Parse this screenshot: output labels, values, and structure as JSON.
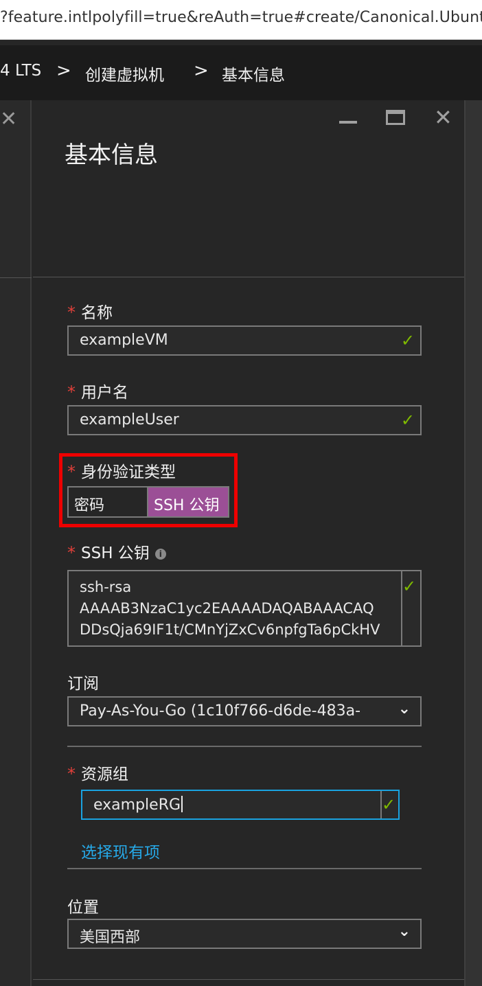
{
  "browser": {
    "url": "?feature.intlpolyfill=true&reAuth=true#create/Canonical.Ubunt"
  },
  "breadcrumb": {
    "items": [
      "4 LTS",
      "创建虚拟机",
      "基本信息"
    ],
    "separator": ">"
  },
  "blade": {
    "title": "基本信息",
    "icons": [
      "minimize-icon",
      "maximize-icon",
      "close-icon"
    ]
  },
  "form": {
    "required_mark": "*",
    "name": {
      "label": "名称",
      "value": "exampleVM",
      "valid": true
    },
    "username": {
      "label": "用户名",
      "value": "exampleUser",
      "valid": true
    },
    "auth_type": {
      "label": "身份验证类型",
      "options": [
        "密码",
        "SSH 公钥"
      ],
      "selected": "SSH 公钥"
    },
    "ssh_key": {
      "label": "SSH 公钥",
      "lines": [
        "ssh-rsa",
        "AAAAB3NzaC1yc2EAAAADAQABAAACAQ",
        "DDsQja69IF1t/CMnYjZxCv6npfgTa6pCkHV"
      ],
      "valid": true
    },
    "subscription": {
      "label": "订阅",
      "value": "Pay-As-You-Go (1c10f766-d6de-483a-"
    },
    "resource_group": {
      "label": "资源组",
      "value": "exampleRG",
      "link": "选择现有项",
      "valid": true
    },
    "location": {
      "label": "位置",
      "value": "美国西部"
    }
  },
  "colors": {
    "accent_selected": "#9b4f96",
    "focus_border": "#1aa3e0",
    "valid_check": "#7fba00",
    "required_star": "#e0403a",
    "highlight_box": "#ee0000",
    "link": "#26a9e8"
  }
}
